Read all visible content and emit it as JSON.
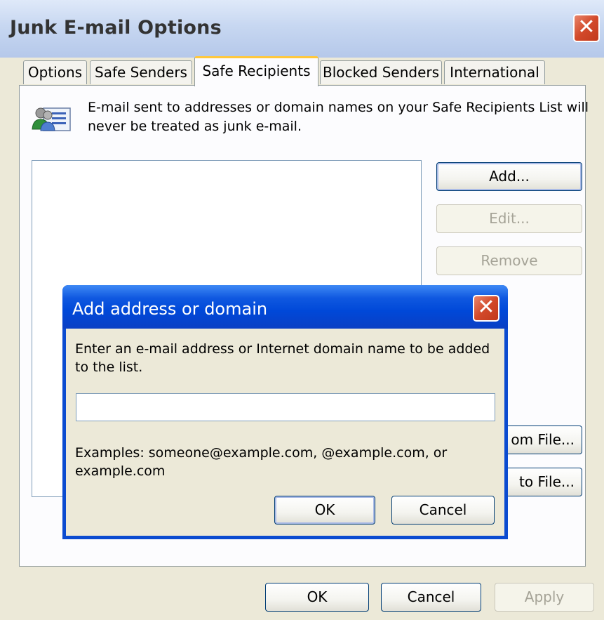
{
  "window": {
    "title": "Junk E-mail Options",
    "close_glyph": "✕",
    "tabs": [
      {
        "label": "Options"
      },
      {
        "label": "Safe Senders"
      },
      {
        "label": "Safe Recipients",
        "active": true
      },
      {
        "label": "Blocked Senders"
      },
      {
        "label": "International"
      }
    ],
    "description": "E-mail sent to addresses or domain names on your Safe Recipients List will never be treated as junk e-mail.",
    "side_buttons": {
      "add": "Add...",
      "edit": "Edit...",
      "remove": "Remove",
      "import_partial": "om File...",
      "export_partial": "to File..."
    },
    "footer": {
      "ok": "OK",
      "cancel": "Cancel",
      "apply": "Apply"
    }
  },
  "dialog": {
    "title": "Add address or domain",
    "close_glyph": "✕",
    "prompt": "Enter an e-mail address or Internet domain name to be added to the list.",
    "input_value": "",
    "examples": "Examples: someone@example.com, @example.com, or example.com",
    "ok": "OK",
    "cancel": "Cancel"
  },
  "colors": {
    "xp_blue": "#0b4bd0",
    "dialog_face": "#ece9d8",
    "close_red": "#d2492a",
    "active_tab_accent": "#ffc83c"
  },
  "icons": {
    "info": "people-list-icon",
    "close": "close-icon"
  }
}
